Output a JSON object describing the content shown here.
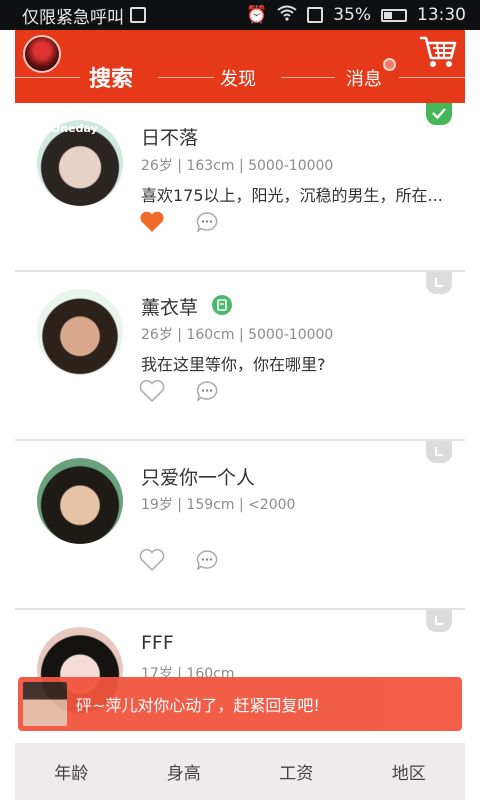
{
  "status_bar": {
    "carrier": "仅限紧急呼叫",
    "battery": "35%",
    "time": "13:30"
  },
  "header": {
    "tabs": [
      {
        "label": "搜索",
        "active": true
      },
      {
        "label": "发现",
        "active": false
      },
      {
        "label": "消息",
        "active": false,
        "has_dot": true
      }
    ]
  },
  "profiles": [
    {
      "name": "日不落",
      "info": "26岁 | 163cm | 5000-10000",
      "bio": "喜欢175以上，阳光，沉稳的男生，所在...",
      "liked": true,
      "photo_text": "Oneday",
      "status": "check"
    },
    {
      "name": "薰衣草",
      "info": "26岁 | 160cm | 5000-10000",
      "bio": "我在这里等你，你在哪里?",
      "liked": false,
      "verified": true,
      "status": "corner"
    },
    {
      "name": "只爱你一个人",
      "info": "19岁 | 159cm | <2000",
      "bio": "",
      "liked": false,
      "status": "corner"
    },
    {
      "name": "FFF",
      "info": "17岁 | 160cm",
      "bio": "",
      "liked": false,
      "status": "corner"
    }
  ],
  "toast": {
    "text": "砰~萍儿对你心动了，赶紧回复吧!"
  },
  "filters": [
    "年龄",
    "身高",
    "工资",
    "地区"
  ],
  "colors": {
    "header": "#e5391a",
    "like": "#f06a2a",
    "verified": "#4cb86b",
    "toast": "#f2553f"
  }
}
